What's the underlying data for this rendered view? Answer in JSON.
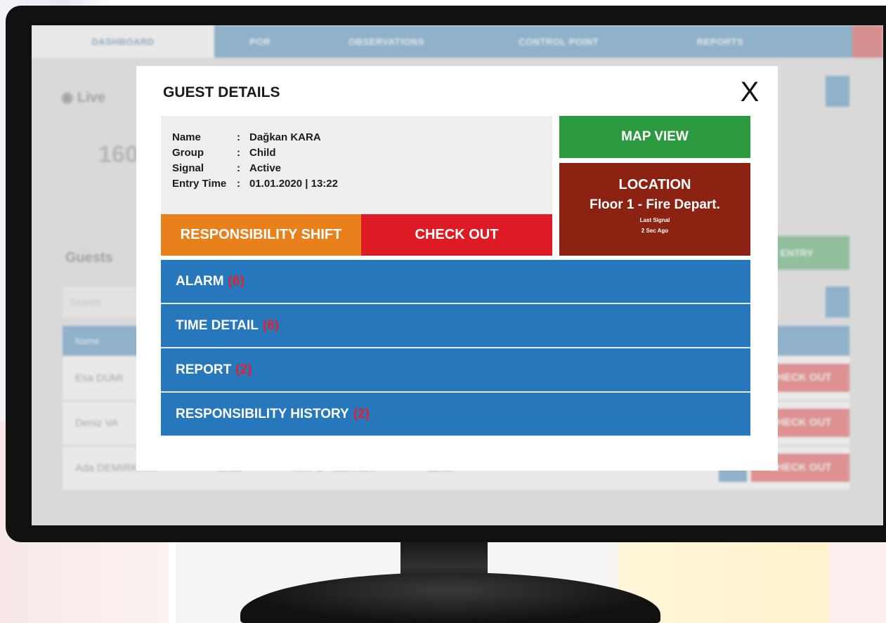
{
  "dashboard": {
    "nav": [
      "DASHBOARD",
      "POR",
      "OBSERVATIONS",
      "CONTROL POINT",
      "REPORTS"
    ],
    "live_label": "Live",
    "counter": "160",
    "guests_heading": "Guests",
    "search_placeholder": "Search",
    "table_header": "Name",
    "rows": [
      {
        "name": "Esa DUMI",
        "group": "",
        "location": "",
        "time": "",
        "action": "CHECK OUT"
      },
      {
        "name": "Deniz VA",
        "group": "",
        "location": "",
        "time": "",
        "action": "CHECK OUT"
      },
      {
        "name": "Ada DEMIRKAYA",
        "group": "Child",
        "location": "KAT 2 - ODA 304",
        "time": "12:30",
        "action": "CHECK OUT"
      }
    ],
    "entry_button": "ENTRY"
  },
  "modal": {
    "title": "GUEST DETAILS",
    "close": "X",
    "info": [
      {
        "key": "Name",
        "sep": ":",
        "value": "Dağkan KARA"
      },
      {
        "key": "Group",
        "sep": ":",
        "value": "Child"
      },
      {
        "key": "Signal",
        "sep": ":",
        "value": "Active"
      },
      {
        "key": "Entry Time",
        "sep": ":",
        "value": "01.01.2020 | 13:22"
      }
    ],
    "responsibility_shift": "RESPONSIBILITY SHIFT",
    "check_out": "CHECK OUT",
    "map_view": "MAP VIEW",
    "location": {
      "title": "LOCATION",
      "place": "Floor 1 - Fire Depart.",
      "last_signal_label": "Last Signal",
      "last_signal_value": "2 Sec Ago"
    },
    "sections": [
      {
        "label": "ALARM",
        "count": "(6)"
      },
      {
        "label": "TIME DETAIL",
        "count": "(6)"
      },
      {
        "label": "REPORT",
        "count": "(2)"
      },
      {
        "label": "RESPONSIBILITY HISTORY",
        "count": "(2)"
      }
    ]
  },
  "colors": {
    "shift_orange": "#e8801c",
    "checkout_red": "#de1b24",
    "map_green": "#2b9a3e",
    "location_maroon": "#8c2212",
    "section_blue": "#2777bd",
    "count_red": "#e5202b"
  }
}
